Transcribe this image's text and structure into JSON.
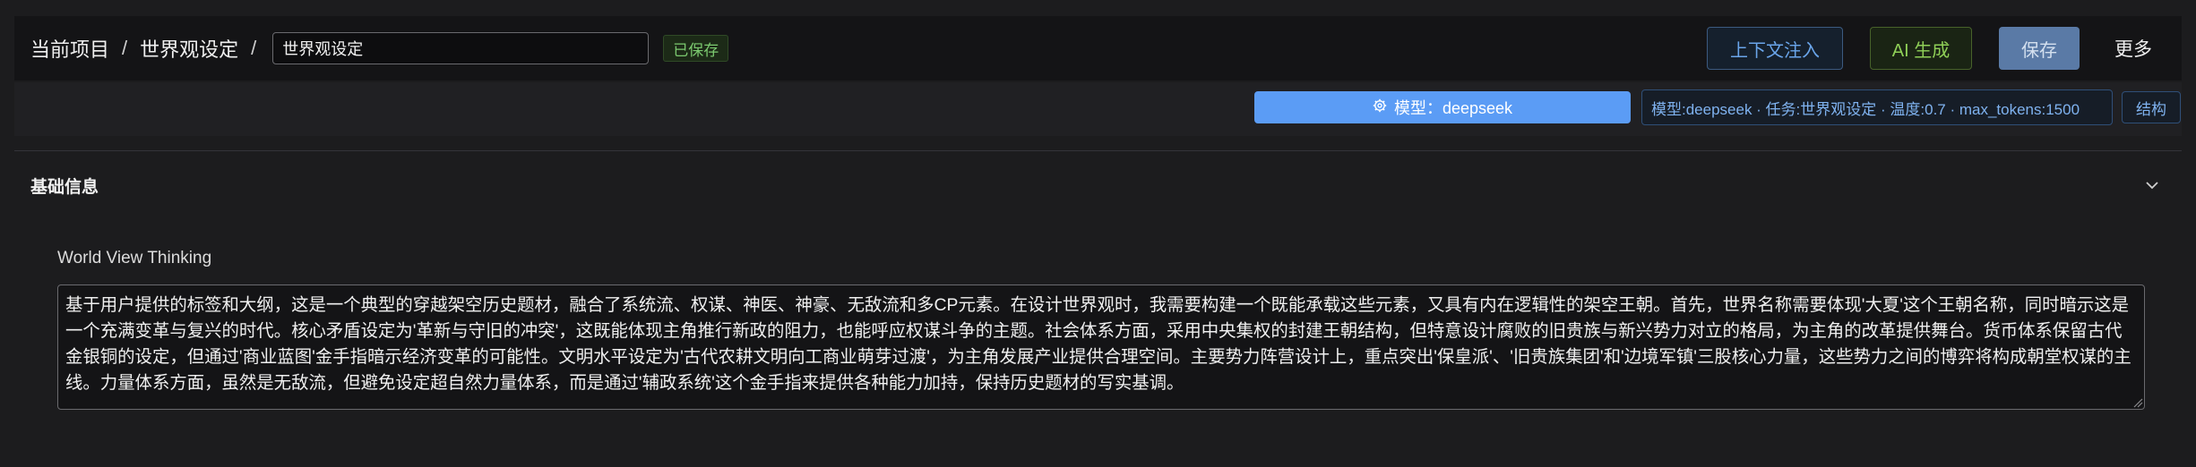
{
  "header": {
    "breadcrumb_project": "当前项目",
    "breadcrumb_sep1": "/",
    "breadcrumb_section": "世界观设定",
    "breadcrumb_sep2": "/",
    "title_value": "世界观设定",
    "saved_badge": "已保存",
    "context_inject_label": "上下文注入",
    "ai_generate_label": "AI 生成",
    "save_label": "保存",
    "more_label": "更多"
  },
  "toolbar": {
    "model_select_label": "模型：deepseek",
    "model_info": "模型:deepseek · 任务:世界观设定 · 温度:0.7 · max_tokens:1500",
    "structure_label": "结构"
  },
  "section": {
    "title": "基础信息",
    "field_label": "World View Thinking",
    "field_value": "基于用户提供的标签和大纲，这是一个典型的穿越架空历史题材，融合了系统流、权谋、神医、神豪、无敌流和多CP元素。在设计世界观时，我需要构建一个既能承载这些元素，又具有内在逻辑性的架空王朝。首先，世界名称需要体现'大夏'这个王朝名称，同时暗示这是一个充满变革与复兴的时代。核心矛盾设定为'革新与守旧的冲突'，这既能体现主角推行新政的阻力，也能呼应权谋斗争的主题。社会体系方面，采用中央集权的封建王朝结构，但特意设计腐败的旧贵族与新兴势力对立的格局，为主角的改革提供舞台。货币体系保留古代金银铜的设定，但通过'商业蓝图'金手指暗示经济变革的可能性。文明水平设定为'古代农耕文明向工商业萌芽过渡'，为主角发展产业提供合理空间。主要势力阵营设计上，重点突出'保皇派'、'旧贵族集团'和'边境军镇'三股核心力量，这些势力之间的博弈将构成朝堂权谋的主线。力量体系方面，虽然是无敌流，但避免设定超自然力量体系，而是通过'辅政系统'这个金手指来提供各种能力加持，保持历史题材的写实基调。"
  },
  "icons": {
    "model_icon": "gear-icon",
    "collapse_icon": "chevron-down-icon",
    "resize_icon": "resize-handle-icon"
  },
  "colors": {
    "accent_blue": "#5b9cf5",
    "saved_green": "#7bc96f",
    "ai_green": "#8fcf57",
    "save_button": "#5a7aa6"
  }
}
